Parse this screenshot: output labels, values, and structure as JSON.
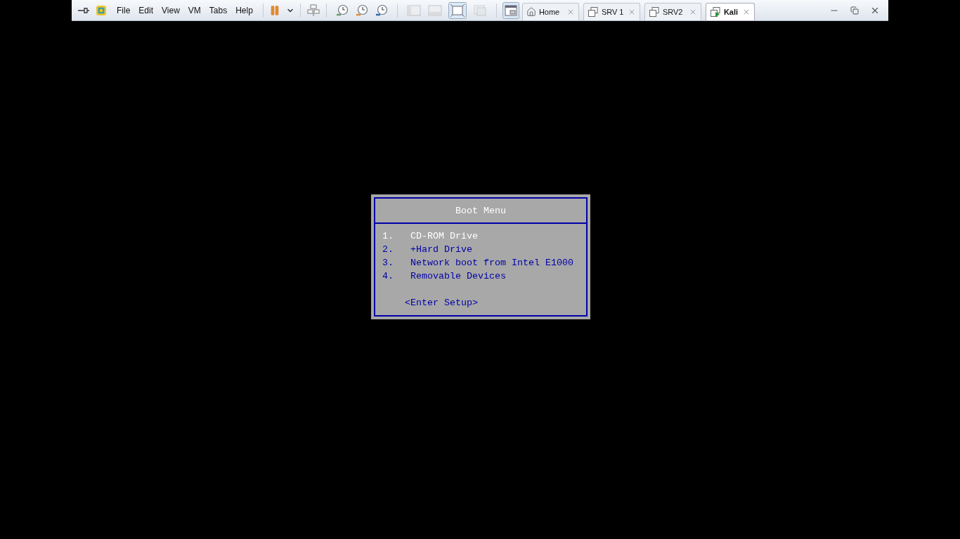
{
  "menu": [
    "File",
    "Edit",
    "View",
    "VM",
    "Tabs",
    "Help"
  ],
  "tabs": [
    {
      "label": "Home",
      "kind": "home",
      "selected": false
    },
    {
      "label": "SRV 1",
      "kind": "vm",
      "selected": false
    },
    {
      "label": "SRV2",
      "kind": "vm",
      "selected": false
    },
    {
      "label": "Kali",
      "kind": "vm-running",
      "selected": true
    }
  ],
  "boot_menu": {
    "title": "Boot Menu",
    "items": [
      {
        "number": "1.",
        "label": "CD-ROM Drive",
        "selected": true
      },
      {
        "number": "2.",
        "label": "+Hard Drive",
        "selected": false
      },
      {
        "number": "3.",
        "label": "Network boot from Intel E1000",
        "selected": false
      },
      {
        "number": "4.",
        "label": "Removable Devices",
        "selected": false
      }
    ],
    "setup": "<Enter Setup>"
  }
}
